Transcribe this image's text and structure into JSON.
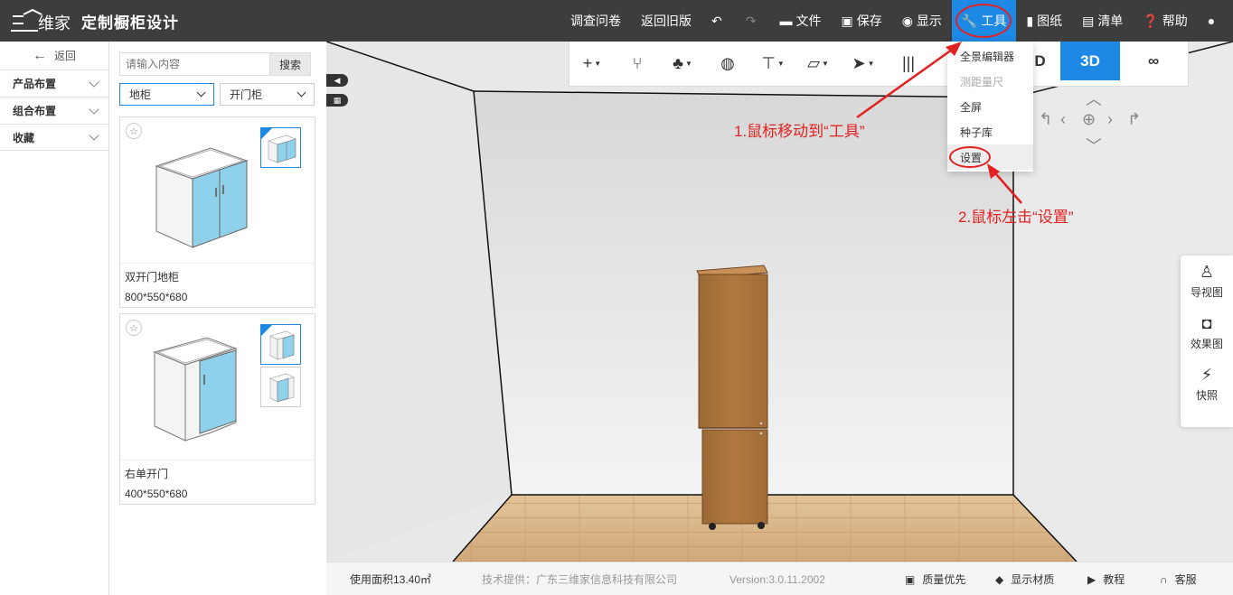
{
  "app": {
    "title": "定制橱柜设计",
    "brand_color": "#1e88e5"
  },
  "topnav": [
    {
      "label": "调查问卷",
      "icon": ""
    },
    {
      "label": "返回旧版",
      "icon": ""
    },
    {
      "label": "",
      "icon": "undo-icon"
    },
    {
      "label": "",
      "icon": "redo-icon"
    },
    {
      "label": "文件",
      "icon": "folder-icon"
    },
    {
      "label": "保存",
      "icon": "save-icon"
    },
    {
      "label": "显示",
      "icon": "eye-icon"
    },
    {
      "label": "工具",
      "icon": "wrench-icon",
      "active": true
    },
    {
      "label": "图纸",
      "icon": "map-icon"
    },
    {
      "label": "清单",
      "icon": "list-icon"
    },
    {
      "label": "帮助",
      "icon": "help-icon"
    },
    {
      "label": "",
      "icon": "user-icon"
    }
  ],
  "left_menu": {
    "back_label": "返回",
    "items": [
      "产品布置",
      "组合布置",
      "收藏"
    ]
  },
  "catalog": {
    "search_placeholder": "请输入内容",
    "search_button": "搜索",
    "filter1": "地柜",
    "filter2": "开门柜",
    "products": [
      {
        "name": "双开门地柜",
        "dims": "800*550*680"
      },
      {
        "name": "右单开门",
        "dims": "400*550*680"
      }
    ]
  },
  "toolbar": {
    "view_3d": "3D",
    "view_other": "D"
  },
  "tools_dropdown": {
    "items": [
      {
        "label": "全景编辑器",
        "disabled": false
      },
      {
        "label": "测距量尺",
        "disabled": true
      },
      {
        "label": "全屏",
        "disabled": false
      },
      {
        "label": "种子库",
        "disabled": false
      },
      {
        "label": "设置",
        "disabled": false
      }
    ]
  },
  "side_tools": [
    "导视图",
    "效果图",
    "快照"
  ],
  "status": {
    "area": "使用面积13.40㎡",
    "provider": "技术提供：广东三维家信息科技有限公司",
    "version": "Version:3.0.11.2002",
    "quality": "质量优先",
    "material": "显示材质",
    "tutorial": "教程",
    "service": "客服"
  },
  "annotations": {
    "step1": "1.鼠标移动到“工具”",
    "step2": "2.鼠标左击“设置”",
    "color": "#e22222"
  }
}
